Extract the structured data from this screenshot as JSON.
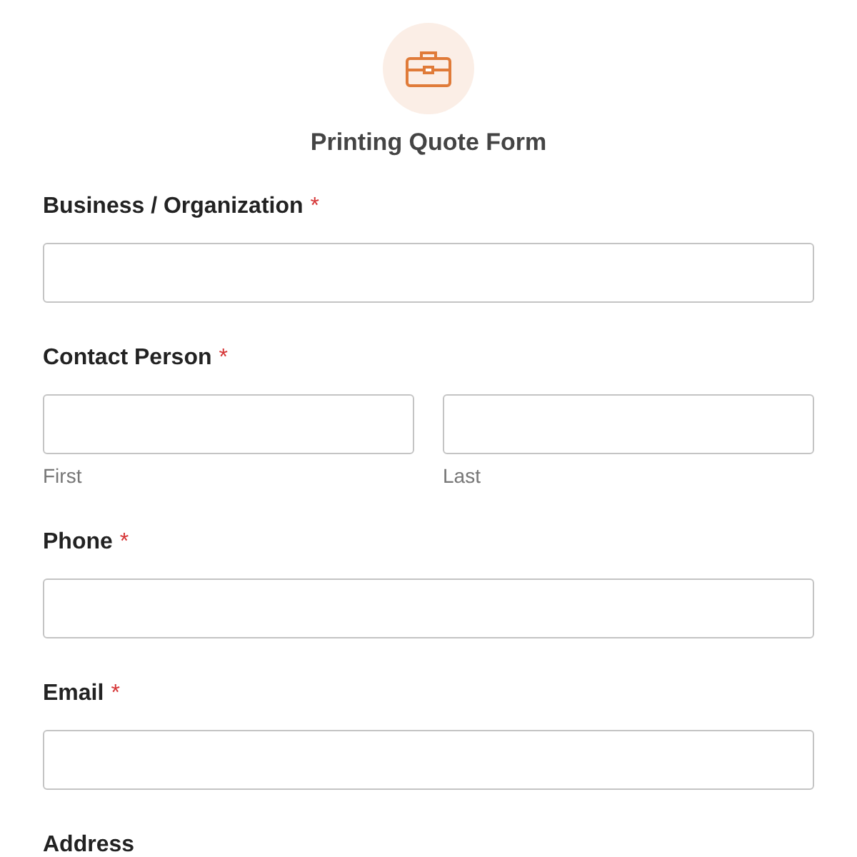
{
  "header": {
    "title": "Printing Quote Form"
  },
  "fields": [
    {
      "kind": "single",
      "label": "Business / Organization",
      "required_mark": "*"
    },
    {
      "kind": "name",
      "label": "Contact Person",
      "required_mark": "*",
      "sublabels": [
        "First",
        "Last"
      ]
    },
    {
      "kind": "single",
      "label": "Phone",
      "required_mark": "*"
    },
    {
      "kind": "single",
      "label": "Email",
      "required_mark": "*"
    },
    {
      "kind": "heading",
      "label": "Address"
    }
  ]
}
